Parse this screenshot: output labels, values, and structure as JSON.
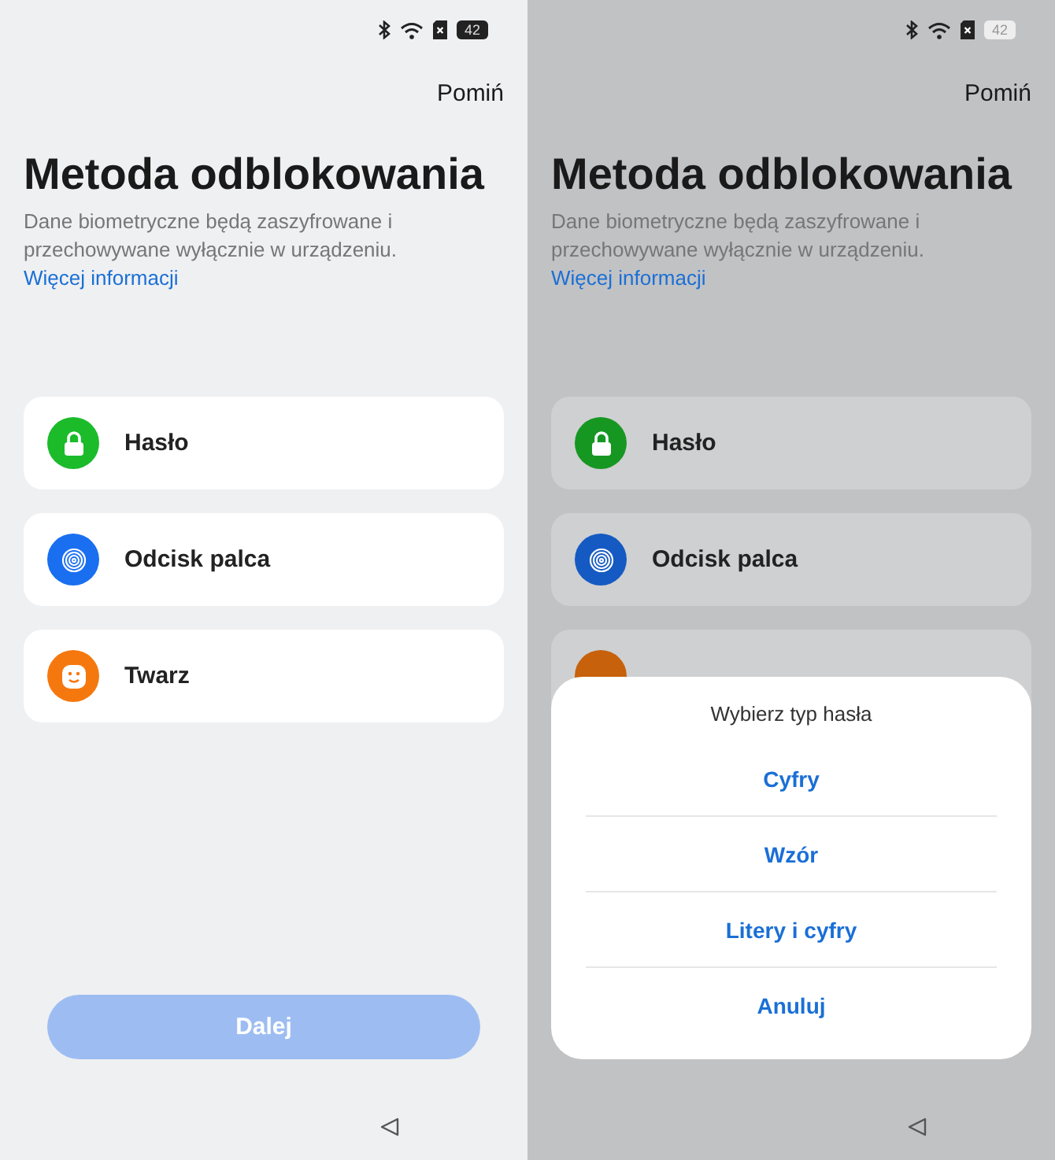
{
  "screens": [
    {
      "dimmed": false,
      "status_bar": {
        "battery": "42"
      },
      "skip": "Pomiń",
      "title": "Metoda odblokowania",
      "description": "Dane biometryczne będą zaszyfrowane i przechowywane wyłącznie w urządzeniu.",
      "link": "Więcej informacji",
      "methods": [
        {
          "kind": "password",
          "color": "#1bbb2a",
          "label": "Hasło"
        },
        {
          "kind": "fingerprint",
          "color": "#1a6ff0",
          "label": "Odcisk palca"
        },
        {
          "kind": "face",
          "color": "#f5780f",
          "label": "Twarz"
        }
      ],
      "next_button": {
        "label": "Dalej",
        "disabled": true
      }
    },
    {
      "dimmed": true,
      "status_bar": {
        "battery": "42"
      },
      "skip": "Pomiń",
      "title": "Metoda odblokowania",
      "description": "Dane biometryczne będą zaszyfrowane i przechowywane wyłącznie w urządzeniu.",
      "link": "Więcej informacji",
      "methods": [
        {
          "kind": "password",
          "color": "#169722",
          "label": "Hasło"
        },
        {
          "kind": "fingerprint",
          "color": "#155ac2",
          "label": "Odcisk palca"
        },
        {
          "color": "#c7610c"
        }
      ],
      "dialog": {
        "title": "Wybierz typ hasła",
        "options": [
          "Cyfry",
          "Wzór",
          "Litery i cyfry",
          "Anuluj"
        ]
      }
    }
  ]
}
